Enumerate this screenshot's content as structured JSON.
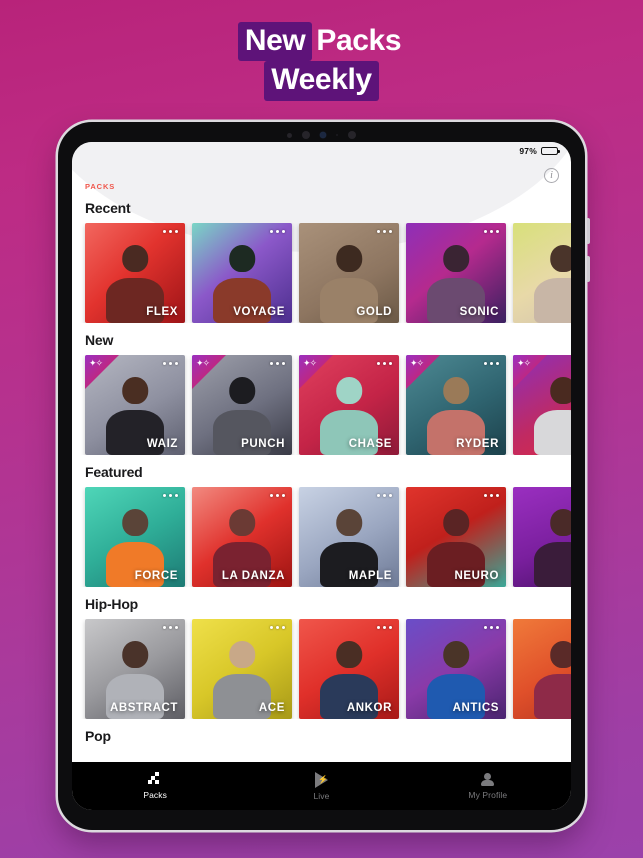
{
  "headline": {
    "line1": [
      {
        "text": "New",
        "highlight": true
      },
      {
        "text": "Packs",
        "highlight": false
      }
    ],
    "line2": [
      {
        "text": "Weekly",
        "highlight": true
      }
    ]
  },
  "device": {
    "status": {
      "battery_percent": "97%"
    },
    "info_icon": "info-icon",
    "info_glyph": "i"
  },
  "app": {
    "eyebrow": "PACKS",
    "accent_color": "#f0564b",
    "sections": [
      {
        "title": "Recent",
        "cards": [
          {
            "label": "FLEX",
            "badge": false,
            "bg": "linear-gradient(135deg,#f2675f 0%,#e2332e 45%,#9e1417 100%)",
            "head": "#4a2a22",
            "body": "#6d2722"
          },
          {
            "label": "VOYAGE",
            "badge": false,
            "bg": "linear-gradient(140deg,#7ad6c6 0%,#8b58c9 45%,#4d2f8f 100%)",
            "head": "#1d2a22",
            "body": "#8a3a2a"
          },
          {
            "label": "GOLD",
            "badge": false,
            "bg": "linear-gradient(150deg,#a9917a 0%,#8d7560 60%,#6b5946 100%)",
            "head": "#3d2a20",
            "body": "#9a8168"
          },
          {
            "label": "SONIC",
            "badge": false,
            "bg": "linear-gradient(140deg,#8e2fb8 0%,#b52a8e 45%,#3a2160 100%)",
            "head": "#3a2433",
            "body": "#6b4a70"
          },
          {
            "label": "",
            "badge": false,
            "bg": "linear-gradient(150deg,#d8e07a 0%,#e8d9a8 50%,#cfc0b0 100%)",
            "head": "#4a342a",
            "body": "#c8b6a6"
          }
        ]
      },
      {
        "title": "New",
        "cards": [
          {
            "label": "WAIZ",
            "badge": true,
            "bg": "linear-gradient(150deg,#b5b7c2 0%,#8e90a0 55%,#5e6070 100%)",
            "head": "#4a2e22",
            "body": "#232228"
          },
          {
            "label": "PUNCH",
            "badge": true,
            "bg": "linear-gradient(150deg,#9ea0ab 0%,#6e7080 55%,#3a3b46 100%)",
            "head": "#1c1c20",
            "body": "#55565f"
          },
          {
            "label": "CHASE",
            "badge": true,
            "bg": "linear-gradient(145deg,#e0405e 0%,#c42447 55%,#8e1a38 100%)",
            "head": "#9fd4c6",
            "body": "#8ec6b8"
          },
          {
            "label": "RYDER",
            "badge": true,
            "bg": "linear-gradient(150deg,#4e8a94 0%,#2f6470 55%,#1d424c 100%)",
            "head": "#9a7a58",
            "body": "#c4726a"
          },
          {
            "label": "",
            "badge": true,
            "bg": "linear-gradient(150deg,#8e2fb8 0%,#c02a62 55%,#e0283f 100%)",
            "head": "#4a2a20",
            "body": "#d8d8da"
          }
        ]
      },
      {
        "title": "Featured",
        "cards": [
          {
            "label": "FORCE",
            "badge": false,
            "bg": "linear-gradient(150deg,#4fd6b8 0%,#2fae98 50%,#1d7a74 100%)",
            "head": "#5a4438",
            "body": "#f07a28"
          },
          {
            "label": "LA DANZA",
            "badge": false,
            "bg": "linear-gradient(145deg,#f28a80 0%,#e0312c 50%,#9e1412 100%)",
            "head": "#6b3a34",
            "body": "#7a2230"
          },
          {
            "label": "MAPLE",
            "badge": false,
            "bg": "linear-gradient(150deg,#c8d2e4 0%,#9aa6c0 55%,#6e7a96 100%)",
            "head": "#5a4438",
            "body": "#1c1c20"
          },
          {
            "label": "NEURO",
            "badge": false,
            "bg": "linear-gradient(150deg,#e0342c 0%,#c0201c 45%,#3aa898 100%)",
            "head": "#5a2424",
            "body": "#6b1e22"
          },
          {
            "label": "",
            "badge": false,
            "bg": "linear-gradient(160deg,#9a2fc0 0%,#7a1f9e 55%,#4a1268 100%)",
            "head": "#4a2a28",
            "body": "#3a1c3a"
          }
        ]
      },
      {
        "title": "Hip-Hop",
        "cards": [
          {
            "label": "ABSTRACT",
            "badge": false,
            "bg": "linear-gradient(150deg,#c8c8ca 0%,#9a9a9e 50%,#5e5e64 100%)",
            "head": "#4a332a",
            "body": "#b0b2b8"
          },
          {
            "label": "ACE",
            "badge": false,
            "bg": "linear-gradient(145deg,#efe04a 0%,#d8c728 50%,#a89a18 100%)",
            "head": "#c8a888",
            "body": "#8e9094"
          },
          {
            "label": "ANKOR",
            "badge": false,
            "bg": "linear-gradient(150deg,#f0564b 0%,#e0302a 50%,#a81a18 100%)",
            "head": "#4a2e24",
            "body": "#2a3a5a"
          },
          {
            "label": "ANTICS",
            "badge": false,
            "bg": "linear-gradient(150deg,#6a4ec8 0%,#8a3aa8 50%,#4a2470 100%)",
            "head": "#4a3428",
            "body": "#1f5ab0"
          },
          {
            "label": "",
            "badge": false,
            "bg": "linear-gradient(150deg,#f07a3a 0%,#e0502a 50%,#b0301e 100%)",
            "head": "#5a2a28",
            "body": "#8e2a48"
          }
        ]
      },
      {
        "title": "Pop",
        "cards": []
      }
    ],
    "tabs": [
      {
        "label": "Packs",
        "icon": "packs-icon",
        "active": true
      },
      {
        "label": "Live",
        "icon": "live-icon",
        "active": false
      },
      {
        "label": "My Profile",
        "icon": "profile-icon",
        "active": false
      }
    ]
  }
}
